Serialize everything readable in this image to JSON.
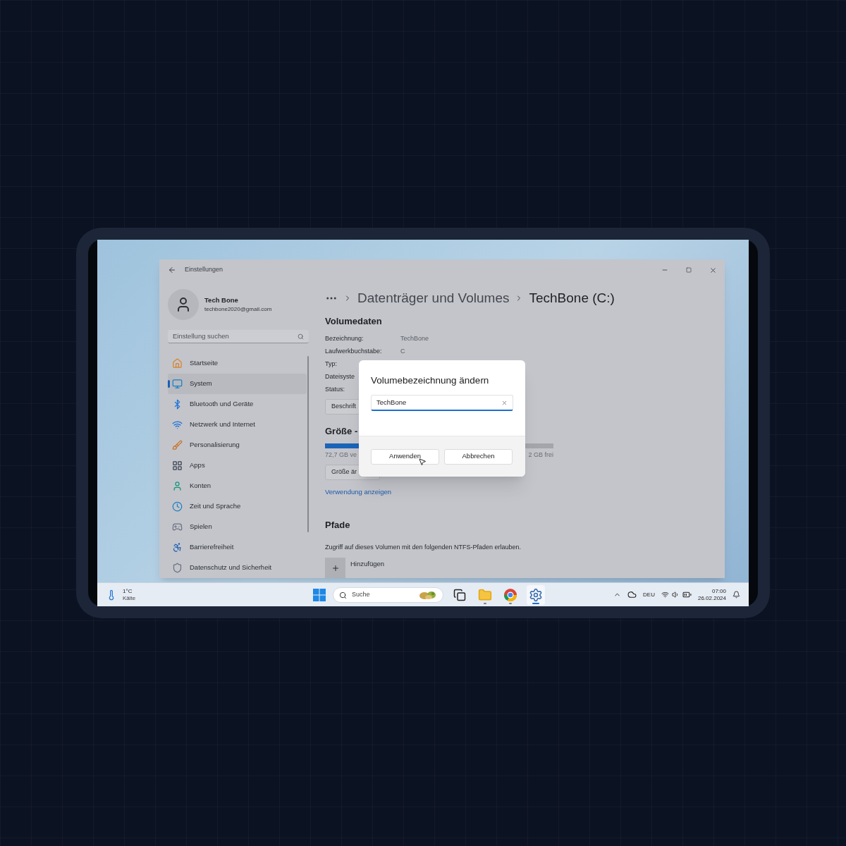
{
  "window": {
    "title": "Einstellungen"
  },
  "account": {
    "name": "Tech Bone",
    "email": "techbone2020@gmail.com"
  },
  "search": {
    "placeholder": "Einstellung suchen"
  },
  "nav": [
    {
      "label": "Startseite",
      "selected": false
    },
    {
      "label": "System",
      "selected": true
    },
    {
      "label": "Bluetooth und Geräte",
      "selected": false
    },
    {
      "label": "Netzwerk und Internet",
      "selected": false
    },
    {
      "label": "Personalisierung",
      "selected": false
    },
    {
      "label": "Apps",
      "selected": false
    },
    {
      "label": "Konten",
      "selected": false
    },
    {
      "label": "Zeit und Sprache",
      "selected": false
    },
    {
      "label": "Spielen",
      "selected": false
    },
    {
      "label": "Barrierefreiheit",
      "selected": false
    },
    {
      "label": "Datenschutz und Sicherheit",
      "selected": false
    }
  ],
  "breadcrumb": [
    "Datenträger und Volumes",
    "TechBone (C:)"
  ],
  "volume": {
    "heading": "Volumedaten",
    "fields": [
      {
        "label": "Bezeichnung:",
        "value": "TechBone"
      },
      {
        "label": "Laufwerkbuchstabe:",
        "value": "C"
      },
      {
        "label": "Typ:"
      },
      {
        "label": "Dateisyste"
      },
      {
        "label": "Status:"
      }
    ],
    "button": "Beschrift"
  },
  "size": {
    "heading": "Größe -",
    "level": 0.35,
    "used": "72,7 GB ve",
    "free": "2 GB frei",
    "button": "Größe är",
    "link": "Verwendung anzeigen"
  },
  "paths": {
    "heading": "Pfade",
    "description": "Zugriff auf dieses Volumen mit den folgenden NTFS-Pfaden erlauben.",
    "add": "Hinzufügen"
  },
  "dialog": {
    "title": "Volumebezeichnung ändern",
    "input": {
      "value": "TechBone"
    },
    "buttons": [
      "Anwenden",
      "Abbrechen"
    ]
  },
  "taskbar": {
    "weather": {
      "temperature": "1°C",
      "condition": "Kälte"
    },
    "search": {
      "placeholder": "Suche"
    },
    "apps": [
      {
        "kind": "taskview",
        "running": false,
        "selected": false
      },
      {
        "kind": "files",
        "running": true,
        "selected": false
      },
      {
        "kind": "browser",
        "running": true,
        "selected": false
      },
      {
        "kind": "settings",
        "running": true,
        "selected": true
      }
    ],
    "language": "DEU",
    "time": "07:00",
    "date": "26.02.2024"
  }
}
